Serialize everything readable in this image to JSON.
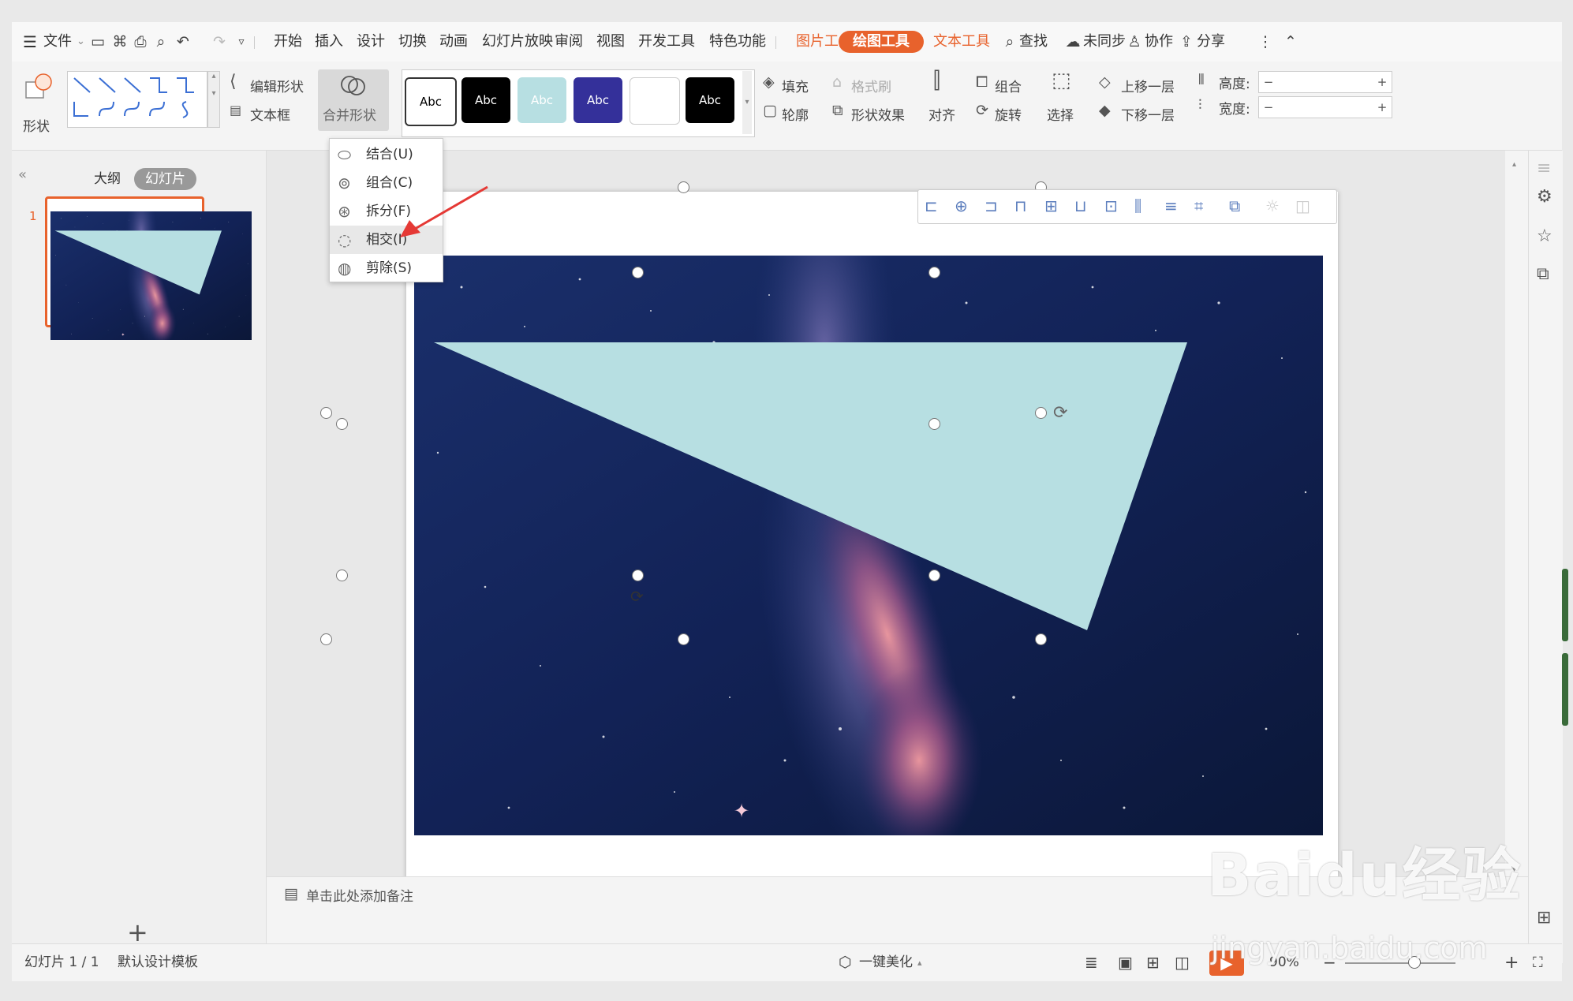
{
  "menubar": {
    "file_label": "文件",
    "tabs": [
      "开始",
      "插入",
      "设计",
      "切换",
      "动画",
      "幻灯片放映",
      "审阅",
      "视图",
      "开发工具",
      "特色功能"
    ],
    "tool_tabs": [
      "图片工具",
      "绘图工具",
      "文本工具"
    ],
    "search_label": "查找",
    "sync_label": "未同步",
    "collab_label": "协作",
    "share_label": "分享"
  },
  "ribbon": {
    "shape_label": "形状",
    "edit_shape_label": "编辑形状",
    "textbox_label": "文本框",
    "merge_shapes_label": "合并形状",
    "style_samples": [
      "Abc",
      "Abc",
      "Abc",
      "Abc",
      "",
      "Abc"
    ],
    "fill_label": "填充",
    "format_painter_label": "格式刷",
    "outline_label": "轮廓",
    "shape_effect_label": "形状效果",
    "align_label": "对齐",
    "group_label": "组合",
    "rotate_label": "旋转",
    "select_label": "选择",
    "bring_forward_label": "上移一层",
    "send_backward_label": "下移一层",
    "height_label": "高度:",
    "width_label": "宽度:"
  },
  "dropdown": {
    "items": [
      "结合(U)",
      "组合(C)",
      "拆分(F)",
      "相交(I)",
      "剪除(S)"
    ],
    "highlighted": "相交(I)"
  },
  "leftpanel": {
    "outline_tab": "大纲",
    "slides_tab": "幻灯片",
    "slide_number": "1"
  },
  "notes": {
    "placeholder": "单击此处添加备注"
  },
  "status": {
    "slide_count": "幻灯片 1 / 1",
    "template": "默认设计模板",
    "beautify": "一键美化",
    "zoom": "90%"
  },
  "watermark": {
    "brand": "Baidu经验",
    "url": "jingyan.baidu.com"
  },
  "colors": {
    "accent": "#e8622c",
    "triangle": "#b7dfe2",
    "space": "#13204a"
  }
}
